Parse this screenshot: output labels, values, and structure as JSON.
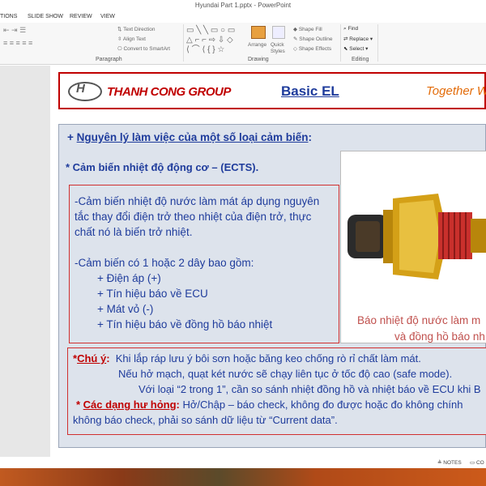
{
  "window": {
    "title": "Hyundai Part 1.pptx - PowerPoint"
  },
  "ribbon_tabs": [
    "TIONS",
    "SLIDE SHOW",
    "REVIEW",
    "VIEW"
  ],
  "ribbon": {
    "text_direction": "Text Direction",
    "align_text": "Align Text",
    "convert_smartart": "Convert to SmartArt",
    "paragraph_label": "Paragraph",
    "arrange": "Arrange",
    "quick_styles": "Quick Styles",
    "shape_fill": "Shape Fill",
    "shape_outline": "Shape Outline",
    "shape_effects": "Shape Effects",
    "drawing_label": "Drawing",
    "find": "Find",
    "replace": "Replace",
    "select": "Select",
    "editing_label": "Editing"
  },
  "slide": {
    "company": "THANH CONG GROUP",
    "title": "Basic EL",
    "slogan": "Together W",
    "heading1_prefix": "+ ",
    "heading1": "Nguyên lý làm việc của một số loại cảm biến",
    "heading1_suffix": ":",
    "heading2": "* Cảm biến nhiệt độ động cơ – (ECTS).",
    "desc": {
      "p1_l1": "-Cảm biến nhiệt độ nước làm mát áp dụng nguyên",
      "p1_l2": "tắc thay đổi điện trở theo nhiệt của điện trở, thực",
      "p1_l3": "chất nó là biến trở nhiệt.",
      "p2": "-Cảm biến có 1 hoặc 2 dây bao gồm:",
      "items": [
        "+ Điện áp (+)",
        "+ Tín hiệu báo về ECU",
        "+ Mát vỏ (-)",
        "+ Tín hiệu báo về đồng hồ báo nhiệt"
      ]
    },
    "caption_l1": "Báo nhiệt độ nước làm m",
    "caption_l2": "và đồng hồ báo nh",
    "note": {
      "label": "Chú ý",
      "l1": "Khi lắp ráp lưu ý bôi sơn hoặc băng keo chống rò rỉ chất làm mát.",
      "l2": "Nếu hở mạch, quạt két nước sẽ chạy liên tục ở tốc độ cao (safe mode).",
      "l3": "Với loại “2 trong 1”, cần so sánh nhiệt đồng hồ và nhiệt báo về ECU khi B",
      "label2": "Các dạng hư hỏng",
      "l4": "Hở/Chập – báo check, không đo được hoặc đo không chính",
      "l5": "không báo check, phải so sánh dữ liệu từ “Current data”."
    }
  },
  "status": {
    "notes": "NOTES",
    "comments": "CO"
  }
}
